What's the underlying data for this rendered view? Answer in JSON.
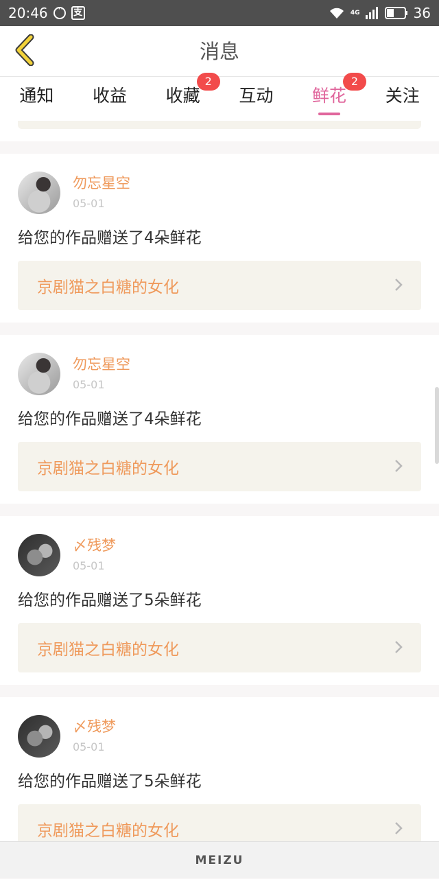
{
  "status_bar": {
    "time": "20:46",
    "network": "4G",
    "battery": "36"
  },
  "header": {
    "title": "消息"
  },
  "tabs": [
    {
      "label": "通知",
      "badge": ""
    },
    {
      "label": "收益",
      "badge": ""
    },
    {
      "label": "收藏",
      "badge": "2"
    },
    {
      "label": "互动",
      "badge": ""
    },
    {
      "label": "鲜花",
      "badge": "2",
      "active": true
    },
    {
      "label": "关注",
      "badge": ""
    }
  ],
  "cards": [
    {
      "user": "勿忘星空",
      "date": "05-01",
      "message": "给您的作品赠送了4朵鲜花",
      "work": "京剧猫之白糖的女化"
    },
    {
      "user": "勿忘星空",
      "date": "05-01",
      "message": "给您的作品赠送了4朵鲜花",
      "work": "京剧猫之白糖的女化"
    },
    {
      "user": "〆残梦",
      "date": "05-01",
      "message": "给您的作品赠送了5朵鲜花",
      "work": "京剧猫之白糖的女化"
    },
    {
      "user": "〆残梦",
      "date": "05-01",
      "message": "给您的作品赠送了5朵鲜花",
      "work": "京剧猫之白糖的女化"
    }
  ],
  "bottom_bar": {
    "brand": "MEIZU"
  },
  "colors": {
    "accent": "#e0669c",
    "username": "#ef9a5c",
    "badge": "#f24b4b",
    "back_arrow": "#f2d23a"
  }
}
